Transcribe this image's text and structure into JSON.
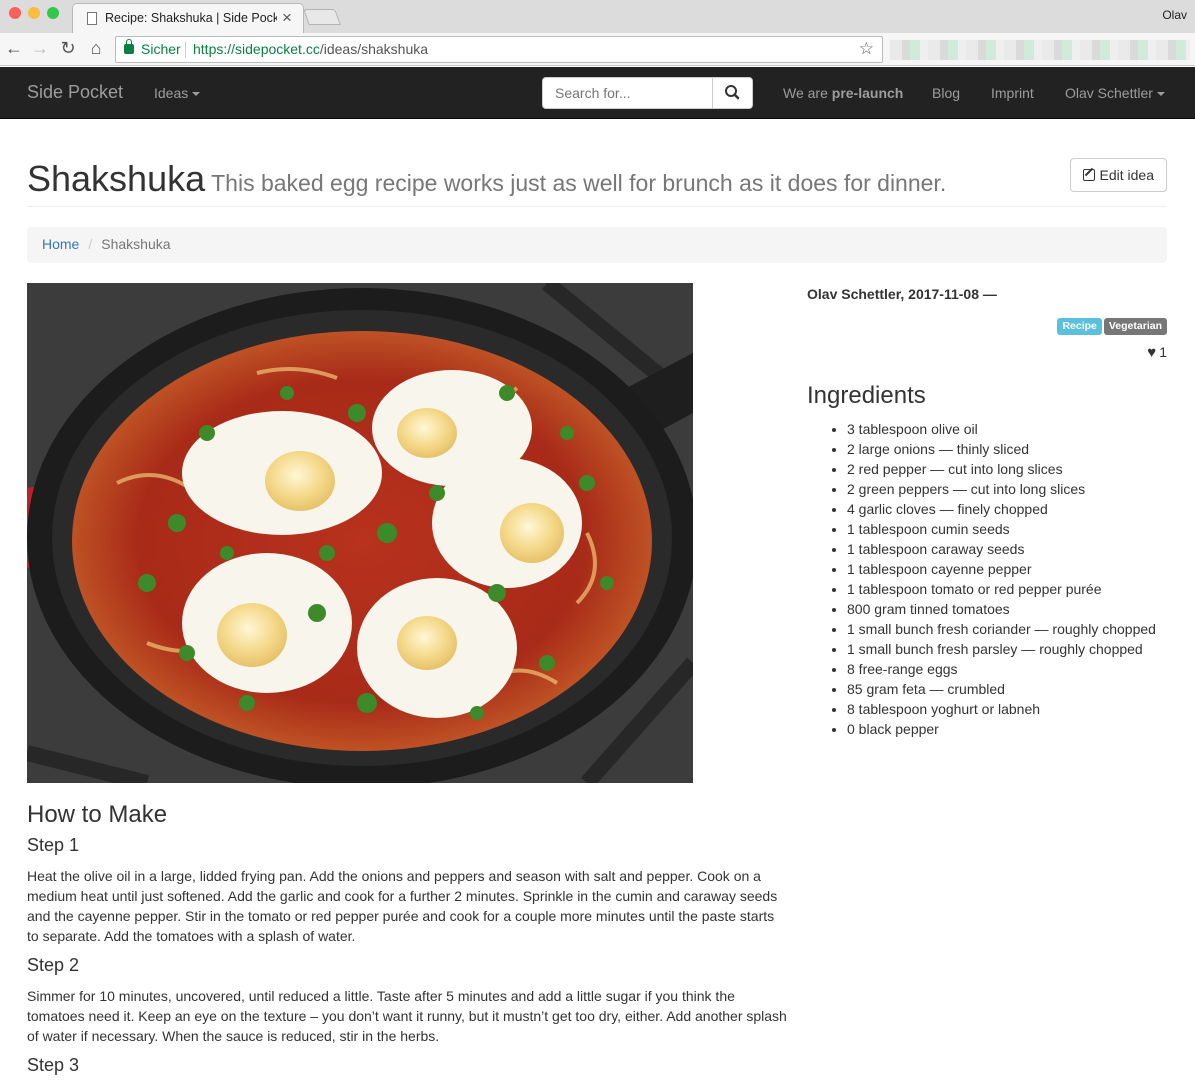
{
  "browser": {
    "tab_title": "Recipe: Shakshuka | Side Pocket",
    "user": "Olav",
    "secure_label": "Sicher",
    "url_host": "https://sidepocket.cc",
    "url_path": "/ideas/shakshuka"
  },
  "nav": {
    "brand": "Side Pocket",
    "ideas": "Ideas",
    "search_placeholder": "Search for...",
    "prelaunch_prefix": "We are ",
    "prelaunch_bold": "pre-launch",
    "blog": "Blog",
    "imprint": "Imprint",
    "user": "Olav Schettler"
  },
  "page": {
    "title": "Shakshuka",
    "subtitle": "This baked egg recipe works just as well for brunch as it does for dinner.",
    "edit_label": "Edit idea"
  },
  "breadcrumb": {
    "home": "Home",
    "current": "Shakshuka"
  },
  "meta": {
    "author_date": "Olav Schettler, 2017-11-08 —",
    "tags": [
      {
        "label": "Recipe",
        "color": "#5bc0de"
      },
      {
        "label": "Vegetarian",
        "color": "#777777"
      }
    ],
    "likes": "1"
  },
  "ingredients": {
    "title": "Ingredients",
    "items": [
      "3 tablespoon olive oil",
      "2 large onions — thinly sliced",
      "2 red pepper — cut into long slices",
      "2 green peppers — cut into long slices",
      "4 garlic cloves — finely chopped",
      "1 tablespoon cumin seeds",
      "1 tablespoon caraway seeds",
      "1 tablespoon cayenne pepper",
      "1 tablespoon tomato or red pepper purée",
      "800 gram tinned tomatoes",
      "1 small bunch fresh coriander — roughly chopped",
      "1 small bunch fresh parsley — roughly chopped",
      "8 free-range eggs",
      "85 gram feta — crumbled",
      "8 tablespoon yoghurt or labneh",
      "0 black pepper"
    ]
  },
  "howto": {
    "title": "How to Make",
    "steps": [
      {
        "title": "Step 1",
        "text": "Heat the olive oil in a large, lidded frying pan. Add the onions and peppers and season with salt and pepper. Cook on a medium heat until just softened. Add the garlic and cook for a further 2 minutes. Sprinkle in the cumin and caraway seeds and the cayenne pepper. Stir in the tomato or red pepper purée and cook for a couple more minutes until the paste starts to separate. Add the tomatoes with a splash of water."
      },
      {
        "title": "Step 2",
        "text": "Simmer for 10 minutes, uncovered, until reduced a little. Taste after 5 minutes and add a little sugar if you think the tomatoes need it. Keep an eye on the texture – you don’t want it runny, but it mustn’t get too dry, either. Add another splash of water if necessary. When the sauce is reduced, stir in the herbs."
      },
      {
        "title": "Step 3",
        "text": ""
      }
    ]
  }
}
